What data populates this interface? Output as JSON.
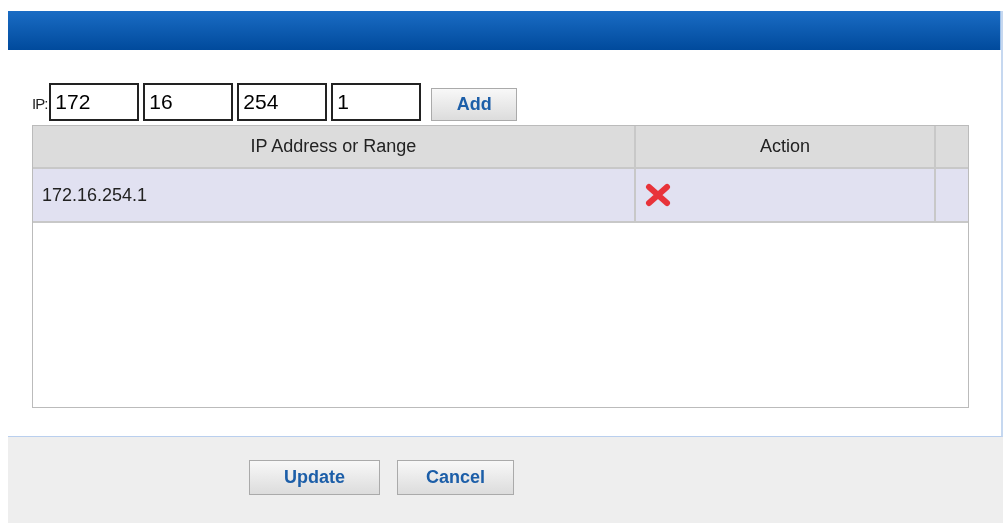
{
  "ip_entry": {
    "label": "IP:",
    "octets": [
      "172",
      "16",
      "254",
      "1"
    ],
    "add_button": "Add"
  },
  "table": {
    "columns": [
      "IP Address or Range",
      "Action"
    ],
    "rows": [
      {
        "address": "172.16.254.1",
        "selected": true
      }
    ]
  },
  "buttons": [
    "Update",
    "Cancel"
  ]
}
